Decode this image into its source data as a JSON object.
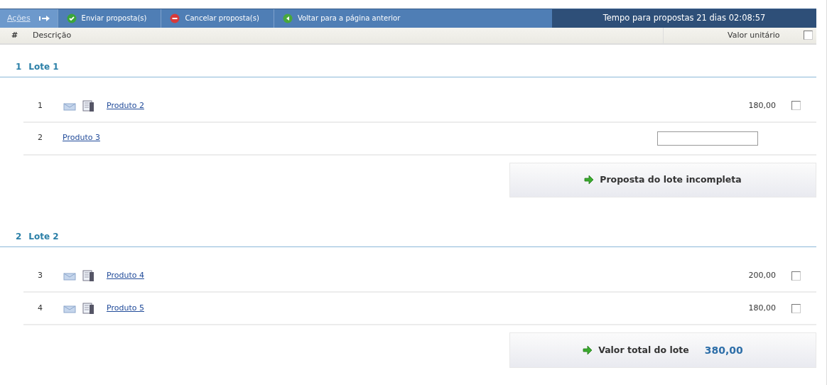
{
  "toolbar": {
    "label": "Ações",
    "actions": [
      {
        "kind": "send",
        "label": "Enviar proposta(s)"
      },
      {
        "kind": "cancel",
        "label": "Cancelar proposta(s)"
      },
      {
        "kind": "back",
        "label": "Voltar para a página anterior"
      }
    ],
    "timer": "Tempo para propostas  21 dias 02:08:57"
  },
  "columns": {
    "number": "#",
    "description": "Descrição",
    "unit_value": "Valor unitário",
    "select_all_checked": false
  },
  "lots": [
    {
      "number": "1",
      "title": "Lote 1",
      "items": [
        {
          "kind": "priced",
          "number": "1",
          "name": "Produto 2",
          "value": "180,00",
          "checked": false
        },
        {
          "kind": "input",
          "number": "2",
          "name": "Produto 3"
        }
      ],
      "footer": {
        "kind": "status",
        "label": "Proposta do lote incompleta"
      }
    },
    {
      "number": "2",
      "title": "Lote 2",
      "items": [
        {
          "kind": "priced",
          "number": "3",
          "name": "Produto 4",
          "value": "200,00",
          "checked": false
        },
        {
          "kind": "priced",
          "number": "4",
          "name": "Produto 5",
          "value": "180,00",
          "checked": false
        }
      ],
      "footer": {
        "kind": "total",
        "label": "Valor total do lote",
        "value": "380,00"
      }
    }
  ]
}
